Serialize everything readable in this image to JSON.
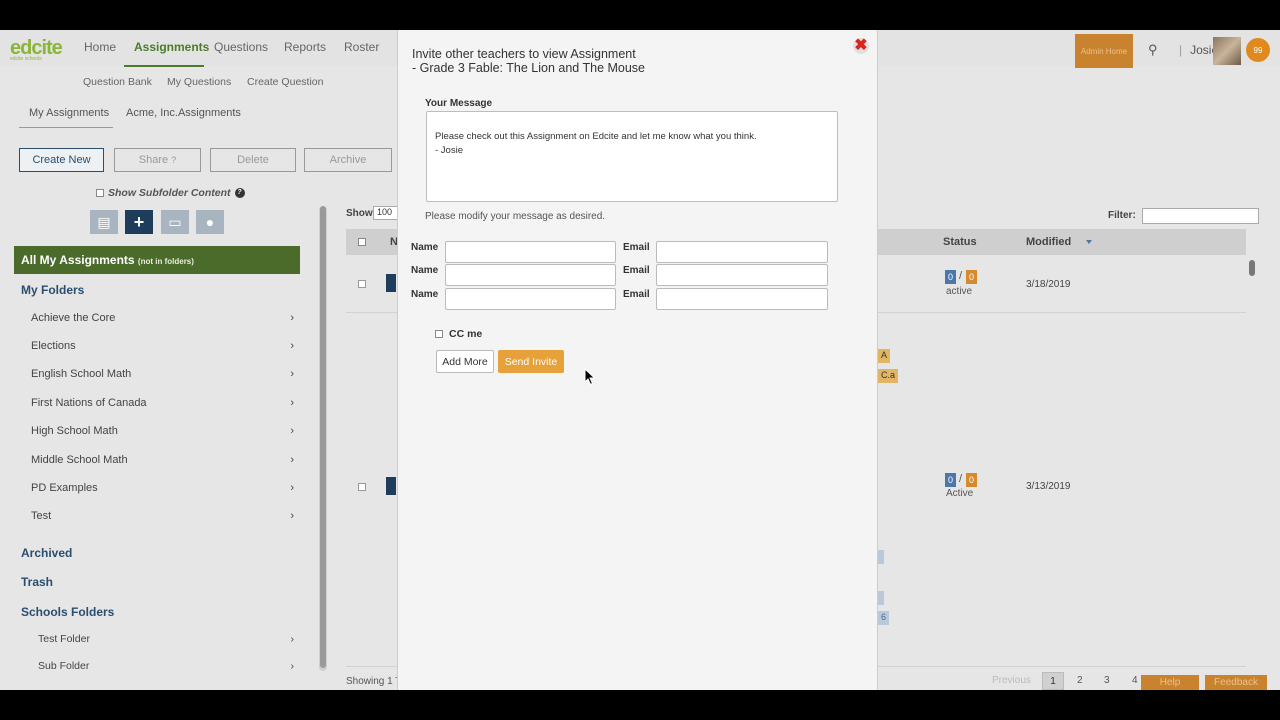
{
  "nav": {
    "logo": "edcite",
    "logo_sub": "edcite schools",
    "items": [
      "Home",
      "Assignments",
      "Questions",
      "Reports",
      "Roster"
    ],
    "admin_home": "Admin Home",
    "user": "Josie",
    "notifications": "99"
  },
  "subnav": [
    "Question Bank",
    "My Questions",
    "Create Question"
  ],
  "tabs": [
    "My Assignments",
    "Acme, Inc.Assignments"
  ],
  "actions": {
    "create_new": "Create New",
    "share": "Share",
    "delete": "Delete",
    "archive": "Archive"
  },
  "subfolder_label": "Show Subfolder Content",
  "sidebar": {
    "all_assignments": "All My Assignments",
    "all_assignments_note": "(not in folders)",
    "my_folders": "My Folders",
    "folders": [
      "Achieve the Core",
      "Elections",
      "English School Math",
      "First Nations of Canada",
      "High School Math",
      "Middle School Math",
      "PD Examples",
      "Test"
    ],
    "archived": "Archived",
    "trash": "Trash",
    "schools_folders": "Schools Folders",
    "school_subfolders": [
      "Test Folder",
      "Sub Folder"
    ]
  },
  "table": {
    "show_label": "Show",
    "show_value": "100",
    "filter_label": "Filter:",
    "col_n": "N",
    "col_status": "Status",
    "col_modified": "Modified",
    "rows": [
      {
        "s1": "0",
        "s2": "0",
        "status": "active",
        "modified": "3/18/2019"
      },
      {
        "s1": "0",
        "s2": "0",
        "status": "Active",
        "modified": "3/13/2019"
      }
    ],
    "tag_a": "A",
    "tag_ca": "C.a",
    "tag_6": "6",
    "showing": "Showing 1 T",
    "pager_prev": "Previous",
    "pages": [
      "1",
      "2",
      "3",
      "4"
    ],
    "help": "Help",
    "feedback": "Feedback"
  },
  "modal": {
    "title_line1": "Invite other teachers to view Assignment",
    "title_line2": "- Grade 3 Fable: The Lion and The Mouse",
    "message_label": "Your Message",
    "message": "Please check out this Assignment on Edcite and let me know what you think.\n- Josie",
    "hint": "Please modify your message as desired.",
    "name_label": "Name",
    "email_label": "Email",
    "cc_label": "CC me",
    "add_more": "Add More",
    "send_invite": "Send Invite"
  },
  "colors": {
    "brand_green": "#4a7d2a",
    "orange": "#e7a13a",
    "navy": "#1e3d5a",
    "close_red": "#d9261c"
  }
}
